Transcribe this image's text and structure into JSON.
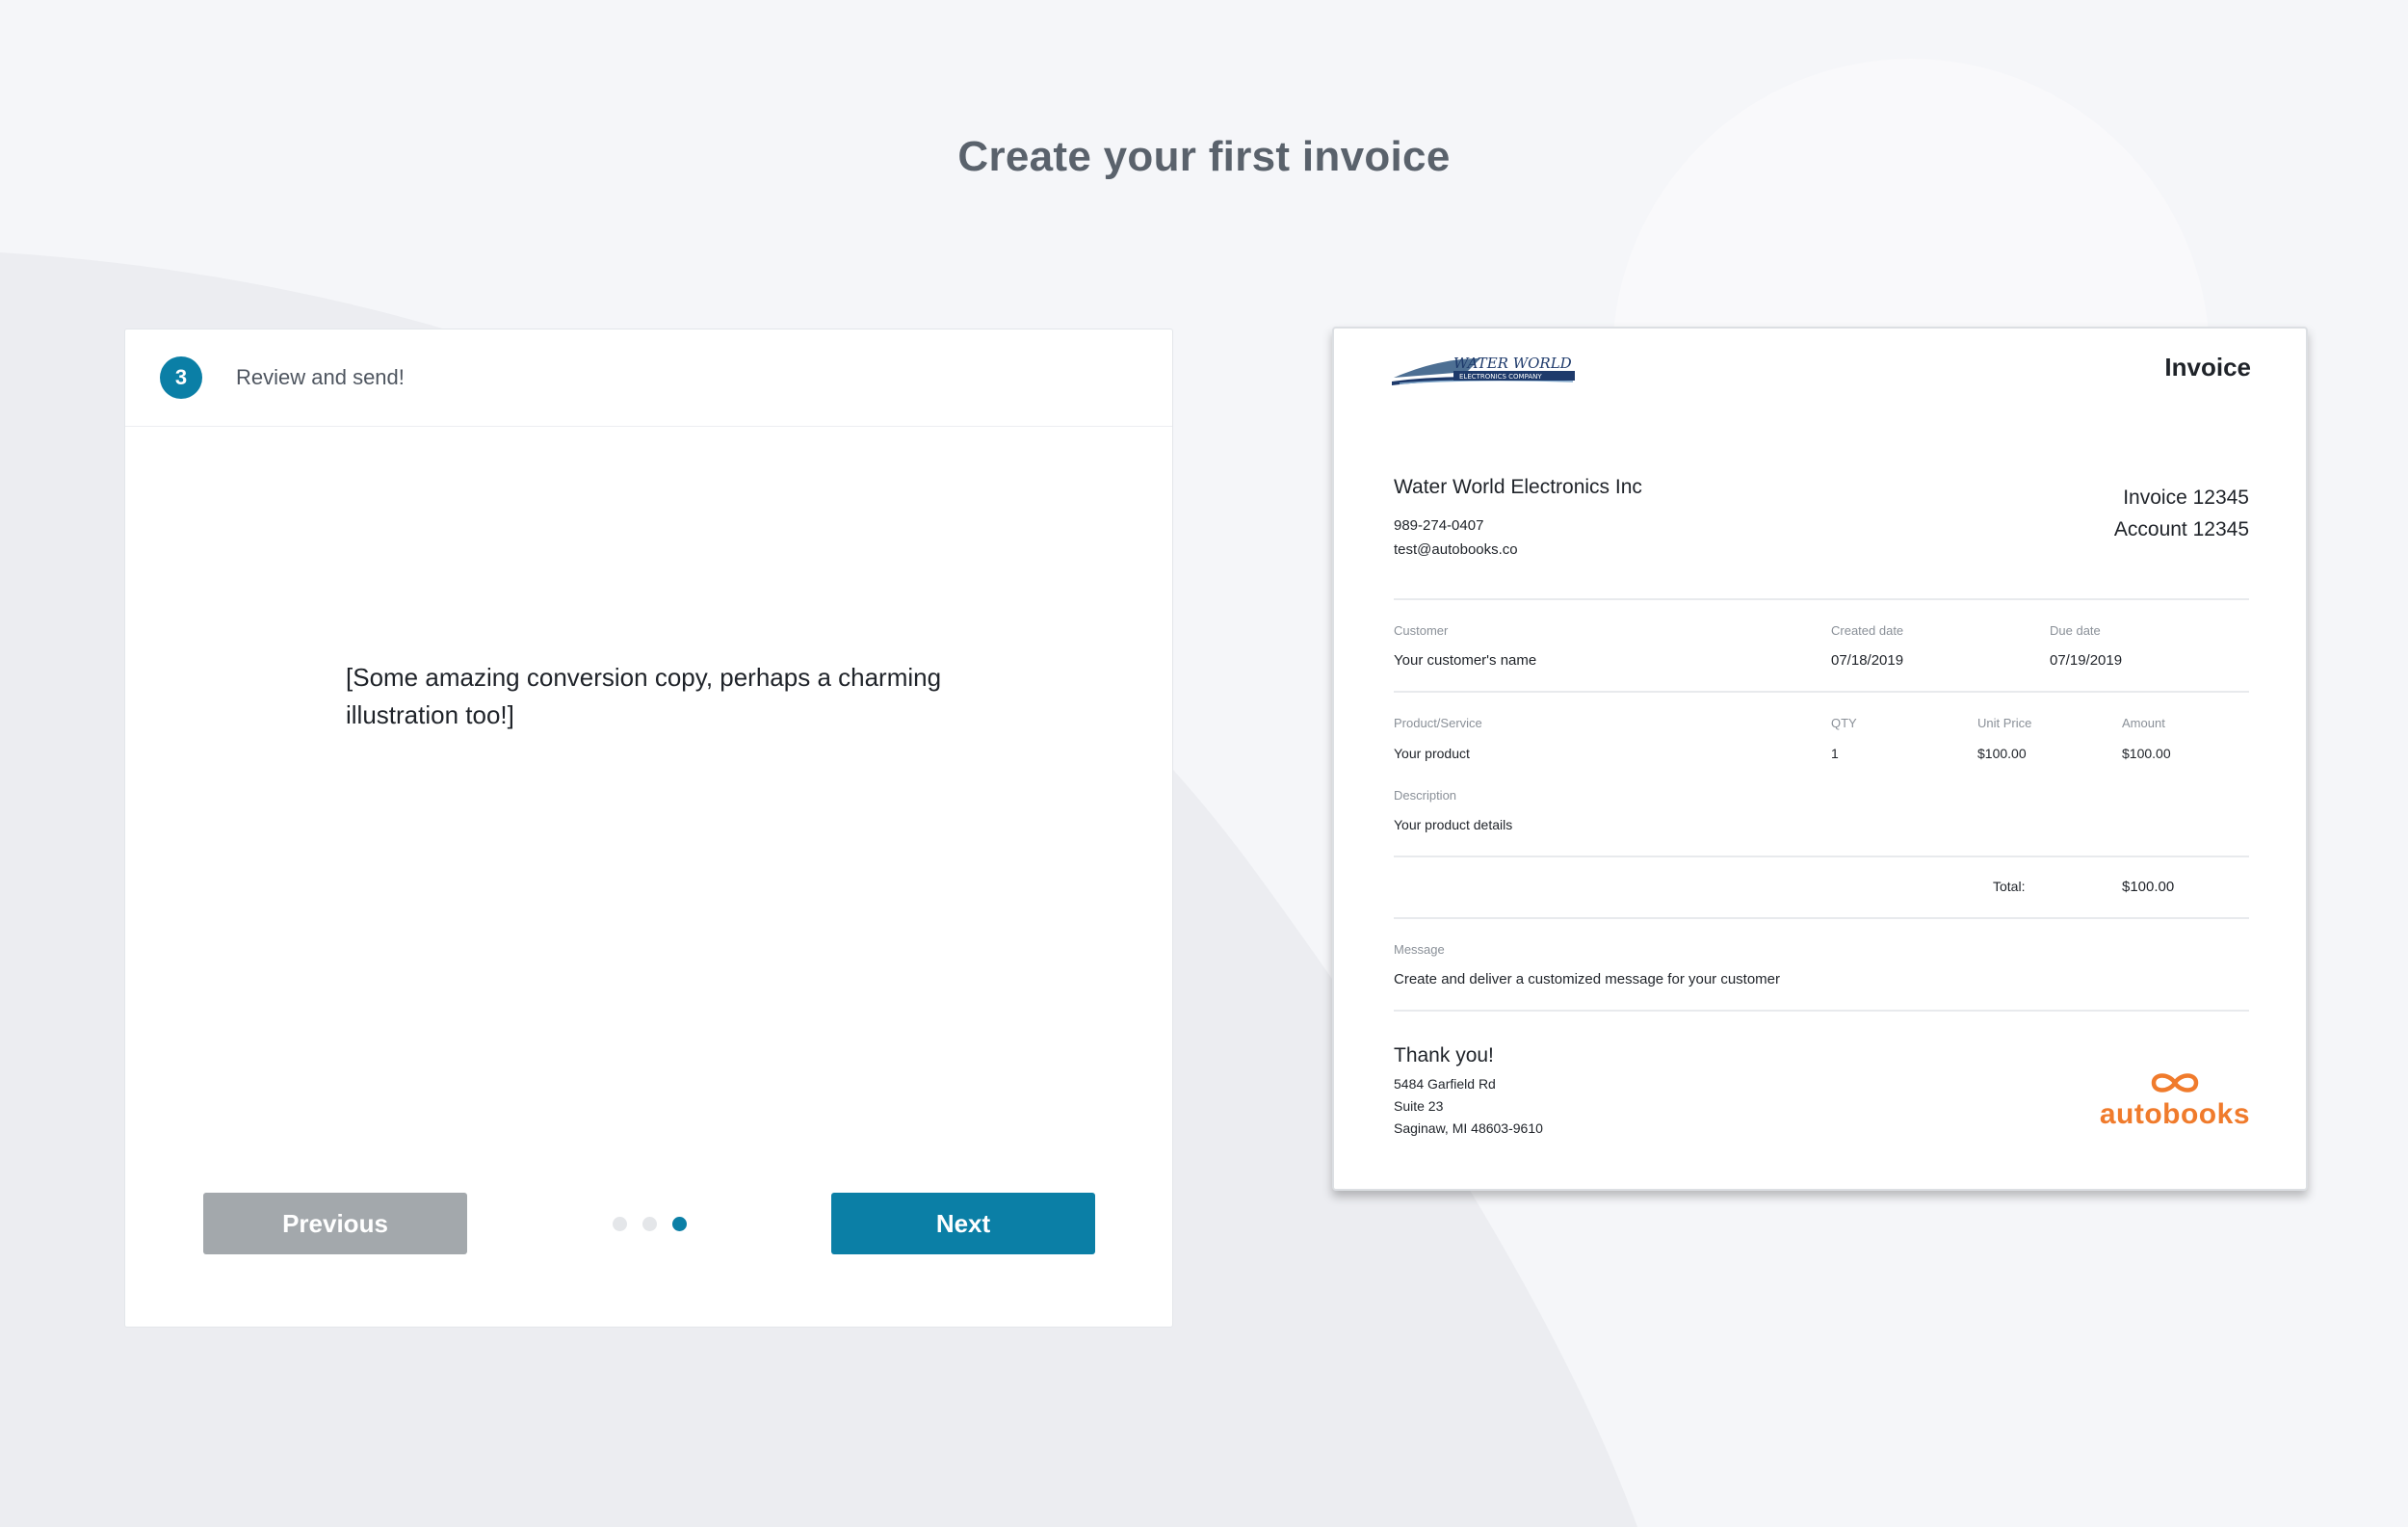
{
  "page": {
    "title": "Create your first invoice"
  },
  "wizard": {
    "step_number": "3",
    "step_title": "Review and send!",
    "copy": "[Some amazing conversion copy, perhaps a charming illustration too!]",
    "previous_label": "Previous",
    "next_label": "Next",
    "pager": {
      "total": 3,
      "current": 3
    }
  },
  "invoice": {
    "logo_text": "WATER WORLD",
    "logo_subtext": "ELECTRONICS COMPANY",
    "heading": "Invoice",
    "company": {
      "name": "Water World Electronics Inc",
      "phone": "989-274-0407",
      "email": "test@autobooks.co"
    },
    "invoice_number": "Invoice 12345",
    "account_number": "Account 12345",
    "labels": {
      "customer": "Customer",
      "created_date": "Created date",
      "due_date": "Due date",
      "product": "Product/Service",
      "qty": "QTY",
      "unit_price": "Unit Price",
      "amount": "Amount",
      "description": "Description",
      "total": "Total:",
      "message": "Message"
    },
    "customer_name": "Your customer's name",
    "created_date": "07/18/2019",
    "due_date": "07/19/2019",
    "line_item": {
      "product": "Your product",
      "qty": "1",
      "unit_price": "$100.00",
      "amount": "$100.00",
      "description": "Your product details"
    },
    "total": "$100.00",
    "message": "Create and deliver a customized message for your customer",
    "thank_you": "Thank you!",
    "address": [
      "5484 Garfield Rd",
      "Suite 23",
      "Saginaw, MI 48603-9610"
    ],
    "brand": "autobooks"
  },
  "colors": {
    "primary": "#0b7fa6",
    "disabled": "#a3a8ac",
    "brand": "#f07b2c",
    "background": "#f5f6f9"
  }
}
